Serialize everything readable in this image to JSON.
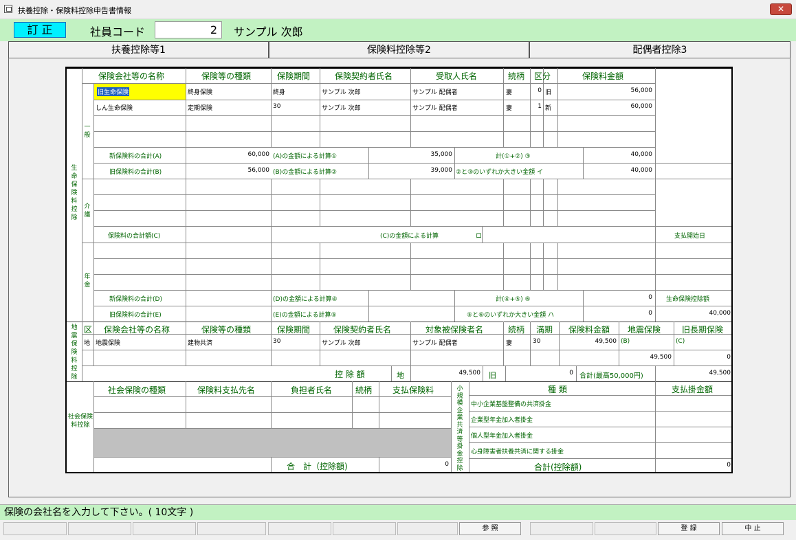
{
  "window": {
    "title": "扶養控除・保険料控除申告書情報",
    "close": "✕"
  },
  "header": {
    "mode": "訂 正",
    "emp_label": "社員コード",
    "emp_code": "2",
    "emp_name": "サンプル 次郎"
  },
  "tabs": [
    "扶養控除等1",
    "保険料控除等2",
    "配偶者控除3"
  ],
  "status_message": "保険の会社名を入力して下さい。( 10文字 )",
  "fkeys": {
    "ref": "参 照",
    "register": "登 録",
    "stop": "中 止"
  },
  "life": {
    "section": "生命保険料控除",
    "sub_general": "一般",
    "sub_care": "介護",
    "sub_pension": "年金",
    "headers": [
      "保険会社等の名称",
      "保険等の種類",
      "保険期間",
      "保険契約者氏名",
      "受取人氏名",
      "続柄",
      "区分",
      "保険料金額"
    ],
    "rows": [
      {
        "company": "旧生命保険",
        "type": "終身保険",
        "period": "終身",
        "holder": "サンプル 次郎",
        "receiver": "サンプル 配偶者",
        "rel": "妻",
        "code": "0",
        "kubun": "旧",
        "amount": "56,000"
      },
      {
        "company": "しん生命保険",
        "type": "定期保険",
        "period": "30",
        "holder": "サンプル 次郎",
        "receiver": "サンプル 配偶者",
        "rel": "妻",
        "code": "1",
        "kubun": "新",
        "amount": "60,000"
      }
    ],
    "new_total_label": "新保険料の合計(A)",
    "new_total": "60,000",
    "calc_a_label": "(A)の金額による計算①",
    "calc_a": "35,000",
    "sum12_label": "計(①+②) ③",
    "sum12": "40,000",
    "old_total_label": "旧保険料の合計(B)",
    "old_total": "56,000",
    "calc_b_label": "(B)の金額による計算②",
    "calc_b": "39,000",
    "max_label": "②と③のいずれか大きい金額 イ",
    "max_i": "40,000",
    "care_total_label": "保険料の合計額(C)",
    "care_calc_label": "(C)の金額による計算",
    "care_ro": "ロ",
    "pay_start_label": "支払開始日",
    "pen_new_label": "新保険料の合計(D)",
    "pen_calc_d_label": "(D)の金額による計算④",
    "pen_sum_label": "計(④+⑤) ⑥",
    "pen_sum": "0",
    "life_ded_label": "生命保険控除額",
    "pen_old_label": "旧保険料の合計(E)",
    "pen_calc_e_label": "(E)の金額による計算⑤",
    "pen_max_label": "⑤と⑥のいずれか大きい金額 ハ",
    "pen_max": "0",
    "life_ded": "40,000"
  },
  "eq": {
    "section": "地震保険料控除",
    "headers": [
      "区",
      "保険会社等の名称",
      "保険等の種類",
      "保険期間",
      "保険契約者氏名",
      "対象被保険者名",
      "続柄",
      "満期",
      "保険料金額",
      "地震保険",
      "旧長期保険"
    ],
    "row": {
      "kubun": "地",
      "company": "地震保険",
      "type": "建物共済",
      "period": "30",
      "holder": "サンプル 次郎",
      "insured": "サンプル 配偶者",
      "rel": "妻",
      "maturity": "30",
      "amount": "49,500",
      "eq_mark": "(B)",
      "old_mark": "(C)"
    },
    "eq_amount": "49,500",
    "old_amount": "0",
    "ded_label": "控 除 額",
    "chi": "地",
    "chi_amount": "49,500",
    "kyu": "旧",
    "kyu_amount": "0",
    "total_label": "合計(最高50,000円)",
    "total": "49,500"
  },
  "social": {
    "section": "社会保険料控除",
    "headers": [
      "社会保険の種類",
      "保険料支払先名",
      "負担者氏名",
      "続柄",
      "支払保険料"
    ],
    "total_label": "合　計（控除額)",
    "total": "0"
  },
  "small": {
    "section": "小規模企業共済等掛金控除",
    "headers": [
      "種 類",
      "支払掛金額"
    ],
    "items": [
      "中小企業基盤整備の共済掛金",
      "企業型年金加入者掛金",
      "個人型年金加入者掛金",
      "心身障害者扶養共済に関する掛金"
    ],
    "total_label": "合計(控除額)",
    "total": "0"
  }
}
